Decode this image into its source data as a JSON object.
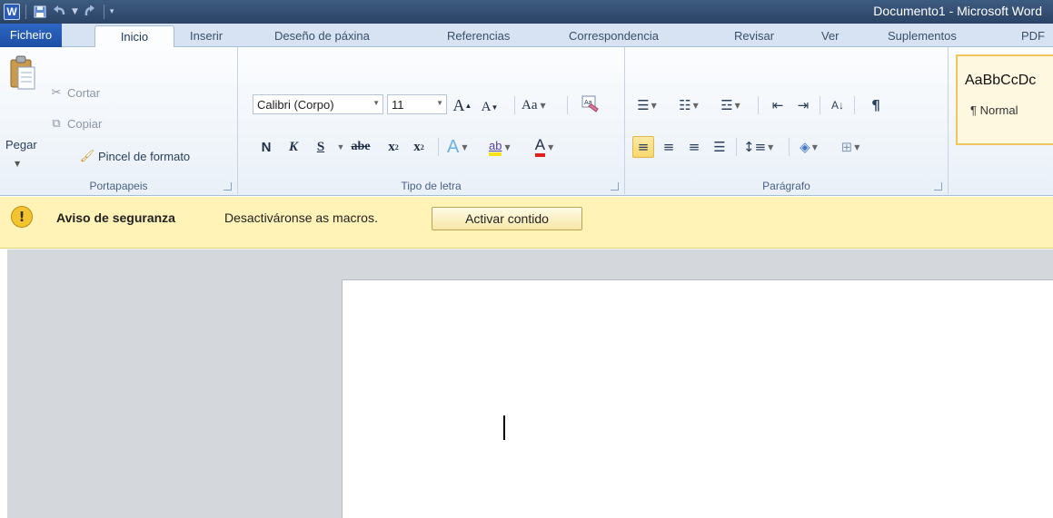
{
  "window": {
    "title": "Documento1 - Microsoft Word",
    "app_icon_letter": "W"
  },
  "tabs": {
    "file": "Ficheiro",
    "items": [
      "Inicio",
      "Inserir",
      "Deseño de páxina",
      "Referencias",
      "Correspondencia",
      "Revisar",
      "Ver",
      "Suplementos",
      "PDF"
    ],
    "active": "Inicio"
  },
  "clipboard": {
    "paste": "Pegar",
    "cut": "Cortar",
    "copy": "Copiar",
    "format_painter": "Pincel de formato",
    "label": "Portapapeis"
  },
  "font": {
    "name": "Calibri (Corpo)",
    "size": "11",
    "grow": "A",
    "shrink": "A",
    "change_case": "Aa",
    "bold": "N",
    "italic": "K",
    "underline": "S",
    "strikethrough": "abe",
    "subscript": "x",
    "superscript": "x",
    "highlight": "ab",
    "font_color": "A",
    "effects": "A",
    "label": "Tipo de letra"
  },
  "paragraph": {
    "label": "Parágrafo",
    "show_marks": "¶",
    "sort": "A↓"
  },
  "styles": {
    "sample": "AaBbCcDc",
    "normal": "¶ Normal"
  },
  "message_bar": {
    "title": "Aviso de seguranza",
    "text": "Desactiváronse as macros.",
    "button": "Activar contido",
    "icon": "!"
  },
  "colors": {
    "accent": "#2d66c4",
    "message_bar": "#fff3b8",
    "workspace": "#d4d7dc"
  }
}
